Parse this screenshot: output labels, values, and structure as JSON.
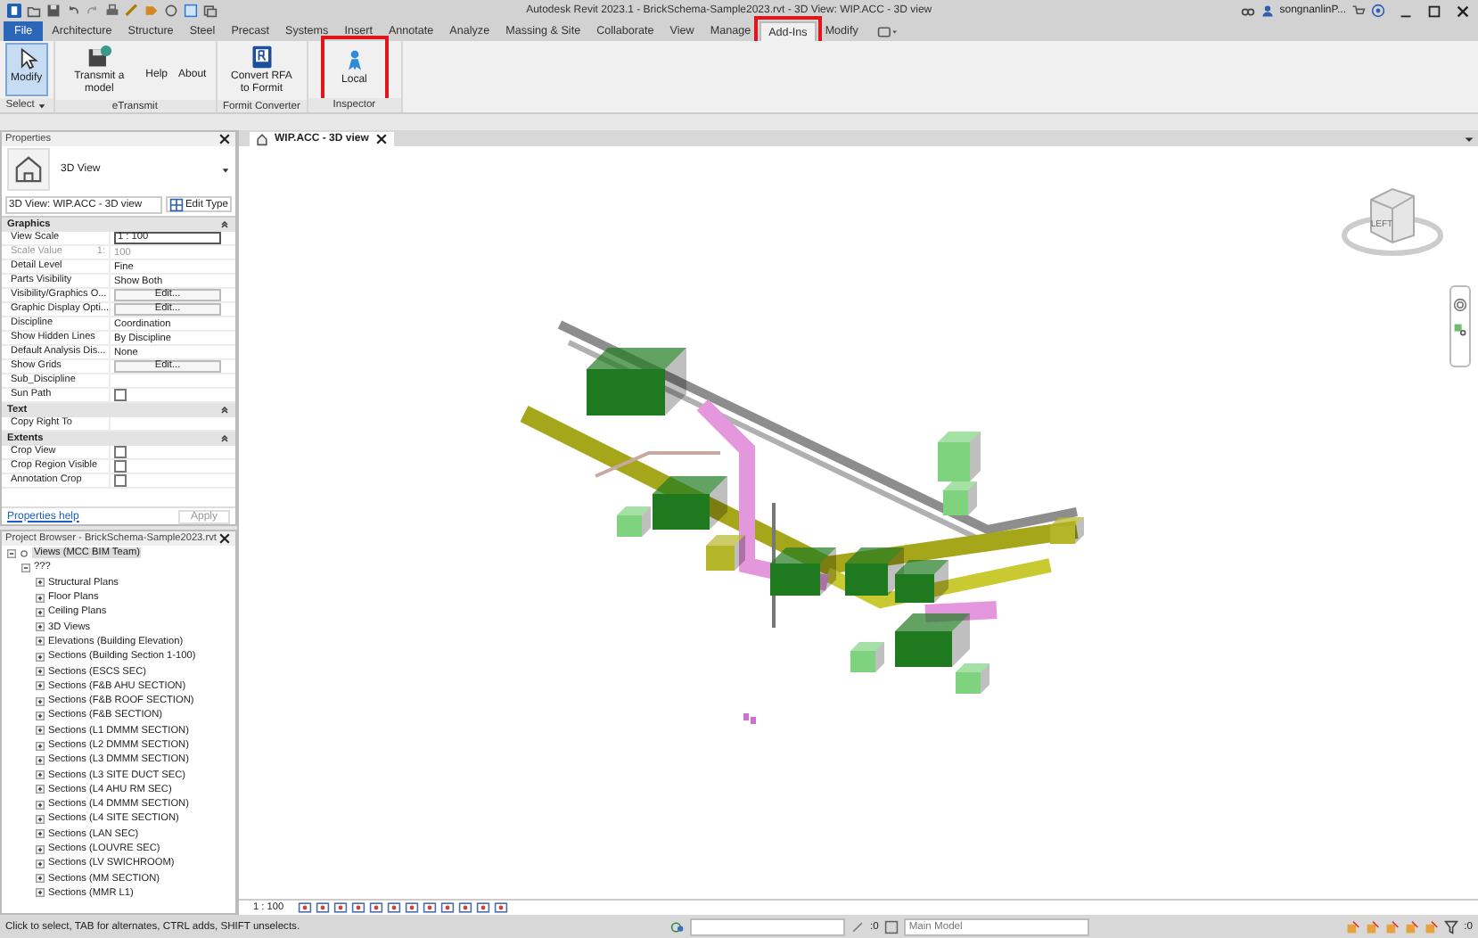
{
  "title_bar": {
    "title": "Autodesk Revit 2023.1 - BrickSchema-Sample2023.rvt - 3D View: WIP.ACC - 3D view",
    "user": "songnanlinP..."
  },
  "ribbon": {
    "tabs": [
      {
        "label": "File",
        "selected": false,
        "highlighted": false,
        "kind": "file"
      },
      {
        "label": "Architecture",
        "selected": false,
        "highlighted": false,
        "kind": "tab"
      },
      {
        "label": "Structure",
        "selected": false,
        "highlighted": false,
        "kind": "tab"
      },
      {
        "label": "Steel",
        "selected": false,
        "highlighted": false,
        "kind": "tab"
      },
      {
        "label": "Precast",
        "selected": false,
        "highlighted": false,
        "kind": "tab"
      },
      {
        "label": "Systems",
        "selected": false,
        "highlighted": false,
        "kind": "tab"
      },
      {
        "label": "Insert",
        "selected": false,
        "highlighted": false,
        "kind": "tab"
      },
      {
        "label": "Annotate",
        "selected": false,
        "highlighted": false,
        "kind": "tab"
      },
      {
        "label": "Analyze",
        "selected": false,
        "highlighted": false,
        "kind": "tab"
      },
      {
        "label": "Massing & Site",
        "selected": false,
        "highlighted": false,
        "kind": "tab"
      },
      {
        "label": "Collaborate",
        "selected": false,
        "highlighted": false,
        "kind": "tab"
      },
      {
        "label": "View",
        "selected": false,
        "highlighted": false,
        "kind": "tab"
      },
      {
        "label": "Manage",
        "selected": false,
        "highlighted": false,
        "kind": "tab"
      },
      {
        "label": "Add-Ins",
        "selected": true,
        "highlighted": true,
        "kind": "tab"
      },
      {
        "label": "Modify",
        "selected": false,
        "highlighted": false,
        "kind": "tab"
      }
    ],
    "panels": [
      {
        "title": "Select",
        "buttons": [
          {
            "label": "Modify",
            "kind": "cursor",
            "selected": true,
            "highlighted": false
          }
        ]
      },
      {
        "title": "eTransmit",
        "buttons": [
          {
            "label": "Transmit a model",
            "kind": "disk",
            "selected": false,
            "highlighted": false
          },
          {
            "label": "Help",
            "kind": "small",
            "selected": false,
            "highlighted": false
          },
          {
            "label": "About",
            "kind": "small",
            "selected": false,
            "highlighted": false
          }
        ]
      },
      {
        "title": "Formit Converter",
        "buttons": [
          {
            "label": "Convert RFA to Formit",
            "kind": "doc",
            "selected": false,
            "highlighted": false
          }
        ]
      },
      {
        "title": "Inspector",
        "buttons": [
          {
            "label": "Local",
            "kind": "person",
            "selected": false,
            "highlighted": true
          }
        ]
      }
    ]
  },
  "properties": {
    "title": "Properties",
    "type_name": "3D View",
    "instance_selector": "3D View: WIP.ACC - 3D view",
    "edit_type": "Edit Type",
    "sections": [
      {
        "title": "Graphics",
        "rows": [
          {
            "name": "View Scale",
            "value": "1 : 100",
            "kind": "field",
            "disabled": false
          },
          {
            "name": "Scale Value",
            "suffix": "1:",
            "value": "100",
            "kind": "text",
            "disabled": true
          },
          {
            "name": "Detail Level",
            "value": "Fine",
            "kind": "text",
            "disabled": false
          },
          {
            "name": "Parts Visibility",
            "value": "Show Both",
            "kind": "text",
            "disabled": false
          },
          {
            "name": "Visibility/Graphics O...",
            "value": "Edit...",
            "kind": "button",
            "disabled": false
          },
          {
            "name": "Graphic Display Opti...",
            "value": "Edit...",
            "kind": "button",
            "disabled": false
          },
          {
            "name": "Discipline",
            "value": "Coordination",
            "kind": "text",
            "disabled": false
          },
          {
            "name": "Show Hidden Lines",
            "value": "By Discipline",
            "kind": "text",
            "disabled": false
          },
          {
            "name": "Default Analysis Dis...",
            "value": "None",
            "kind": "text",
            "disabled": false
          },
          {
            "name": "Show Grids",
            "value": "Edit...",
            "kind": "button",
            "disabled": false
          },
          {
            "name": "Sub_Discipline",
            "kind": "text",
            "disabled": false
          },
          {
            "name": "Sun Path",
            "kind": "checkbox",
            "checked": false,
            "disabled": false
          }
        ]
      },
      {
        "title": "Text",
        "rows": [
          {
            "name": "Copy Right To",
            "kind": "text",
            "disabled": false
          }
        ]
      },
      {
        "title": "Extents",
        "rows": [
          {
            "name": "Crop View",
            "kind": "checkbox",
            "checked": false,
            "disabled": false
          },
          {
            "name": "Crop Region Visible",
            "kind": "checkbox",
            "checked": false,
            "disabled": false
          },
          {
            "name": "Annotation Crop",
            "kind": "checkbox",
            "checked": false,
            "disabled": false
          }
        ]
      }
    ],
    "help_link": "Properties help",
    "apply_button": "Apply"
  },
  "project_browser": {
    "title": "Project Browser - BrickSchema-Sample2023.rvt",
    "tree": [
      {
        "label": "Views (MCC BIM Team)",
        "expanded": true,
        "selected": true,
        "children": [
          {
            "label": "???",
            "expanded": true,
            "selected": false,
            "children": [
              {
                "label": "Structural Plans",
                "expanded": false,
                "selected": false
              },
              {
                "label": "Floor Plans",
                "expanded": false,
                "selected": false
              },
              {
                "label": "Ceiling Plans",
                "expanded": false,
                "selected": false
              },
              {
                "label": "3D Views",
                "expanded": false,
                "selected": false
              },
              {
                "label": "Elevations (Building Elevation)",
                "expanded": false,
                "selected": false
              },
              {
                "label": "Sections (Building Section 1-100)",
                "expanded": false,
                "selected": false
              },
              {
                "label": "Sections (ESCS SEC)",
                "expanded": false,
                "selected": false
              },
              {
                "label": "Sections (F&B AHU SECTION)",
                "expanded": false,
                "selected": false
              },
              {
                "label": "Sections (F&B ROOF SECTION)",
                "expanded": false,
                "selected": false
              },
              {
                "label": "Sections (F&B SECTION)",
                "expanded": false,
                "selected": false
              },
              {
                "label": "Sections (L1 DMMM SECTION)",
                "expanded": false,
                "selected": false
              },
              {
                "label": "Sections (L2 DMMM SECTION)",
                "expanded": false,
                "selected": false
              },
              {
                "label": "Sections (L3 DMMM SECTION)",
                "expanded": false,
                "selected": false
              },
              {
                "label": "Sections (L3 SITE DUCT SEC)",
                "expanded": false,
                "selected": false
              },
              {
                "label": "Sections (L4 AHU RM SEC)",
                "expanded": false,
                "selected": false
              },
              {
                "label": "Sections (L4 DMMM SECTION)",
                "expanded": false,
                "selected": false
              },
              {
                "label": "Sections (L4 SITE SECTION)",
                "expanded": false,
                "selected": false
              },
              {
                "label": "Sections (LAN SEC)",
                "expanded": false,
                "selected": false
              },
              {
                "label": "Sections (LOUVRE SEC)",
                "expanded": false,
                "selected": false
              },
              {
                "label": "Sections (LV SWICHROOM)",
                "expanded": false,
                "selected": false
              },
              {
                "label": "Sections (MM SECTION)",
                "expanded": false,
                "selected": false
              },
              {
                "label": "Sections (MMR L1)",
                "expanded": false,
                "selected": false
              }
            ]
          }
        ]
      }
    ]
  },
  "view": {
    "tab_title": "WIP.ACC - 3D view",
    "viewcube_face": "LEFT",
    "scale": "1 : 100"
  },
  "status_bar": {
    "message": "Click to select, TAB for alternates, CTRL adds, SHIFT unselects.",
    "selection_count": ":0",
    "model": "Main Model",
    "filter_count": ":0"
  }
}
